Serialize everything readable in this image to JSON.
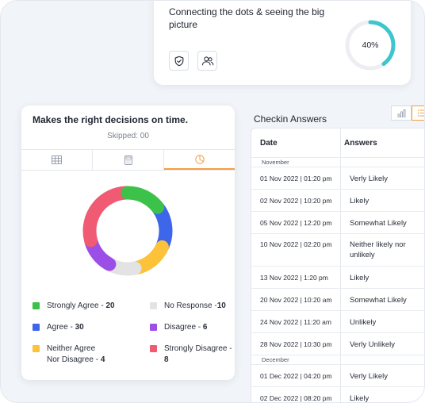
{
  "top_card": {
    "title": "Connecting the dots & seeing the big picture",
    "progress_value": 40,
    "progress_label": "40%",
    "icons": [
      "shield-check-icon",
      "users-icon"
    ]
  },
  "question_card": {
    "title": "Makes the right decisions on time.",
    "skipped": "Skipped: 00",
    "tabs": [
      {
        "icon": "table-icon",
        "active": false
      },
      {
        "icon": "calculator-icon",
        "active": false
      },
      {
        "icon": "pie-chart-icon",
        "active": true
      }
    ],
    "legend": [
      {
        "label": "Strongly Agree - ",
        "value": "20",
        "color": "#3cc24a"
      },
      {
        "label": "No Response -",
        "value": "10",
        "color": "#e3e3e3"
      },
      {
        "label": "Agree - ",
        "value": "30",
        "color": "#3d66ea"
      },
      {
        "label": "Disagree - ",
        "value": "6",
        "color": "#9b4fe6"
      },
      {
        "label": "Neither Agree",
        "label2": "Nor Disagree - ",
        "value": "4",
        "color": "#fbc23a"
      },
      {
        "label": "Strongly Disagree - ",
        "value": "8",
        "color": "#f05a73"
      }
    ]
  },
  "chart_data": {
    "type": "pie",
    "style": "donut",
    "categories": [
      "Strongly Agree",
      "Agree",
      "Neither Agree Nor Disagree",
      "No Response",
      "Disagree",
      "Strongly Disagree"
    ],
    "values": [
      20,
      30,
      4,
      10,
      6,
      8
    ],
    "colors": [
      "#3cc24a",
      "#3d66ea",
      "#fbc23a",
      "#e3e3e3",
      "#9b4fe6",
      "#f05a73"
    ],
    "visual_fractions": [
      0.15,
      0.17,
      0.15,
      0.11,
      0.13,
      0.29
    ],
    "legend_position": "bottom"
  },
  "checkin": {
    "title": "Checkin Answers",
    "view_icons": [
      "bar-chart-icon",
      "list-icon"
    ],
    "headers": {
      "date": "Date",
      "answers": "Answers"
    },
    "groups": [
      {
        "label": "November",
        "rows": [
          {
            "date": "01 Nov 2022 | 01:20 pm",
            "answer": "Verly Likely"
          },
          {
            "date": "02 Nov 2022 | 10:20 pm",
            "answer": "Likely"
          },
          {
            "date": "05 Nov 2022 | 12:20 pm",
            "answer": "Somewhat Likely"
          },
          {
            "date": "10 Nov 2022 | 02:20 pm",
            "answer": "Neither likely nor unlikely"
          },
          {
            "date": "13 Nov 2022 | 1:20 pm",
            "answer": "Likely"
          },
          {
            "date": "20 Nov 2022 | 10:20 am",
            "answer": "Somewhat Likely"
          },
          {
            "date": "24 Nov 2022 | 11:20 am",
            "answer": "Unlikely"
          },
          {
            "date": "28 Nov 2022 | 10:30 pm",
            "answer": "Verly Unlikely"
          }
        ]
      },
      {
        "label": "December",
        "rows": [
          {
            "date": "01 Dec 2022 | 04:20 pm",
            "answer": "Verly Likely"
          },
          {
            "date": "02 Dec 2022 | 08:20 pm",
            "answer": "Likely"
          }
        ]
      }
    ]
  },
  "colors": {
    "accent": "#f59e42",
    "progress": "#3cc6cf"
  }
}
